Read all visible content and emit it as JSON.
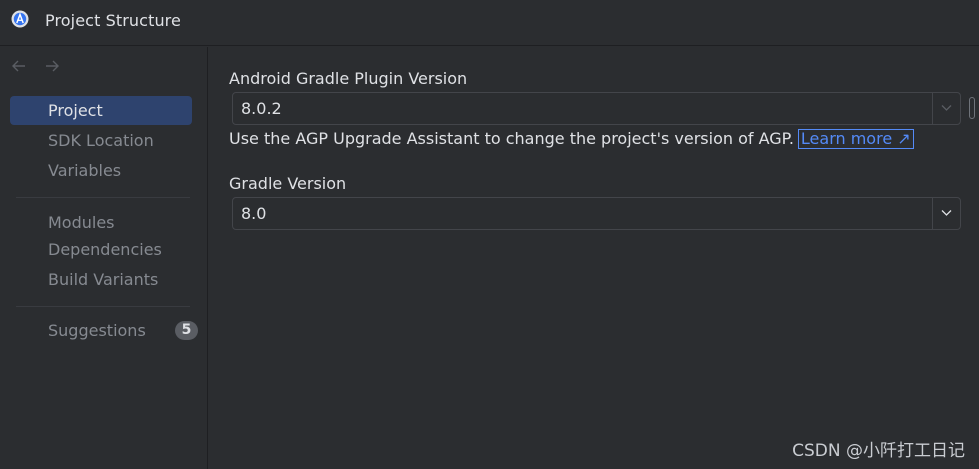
{
  "window": {
    "title": "Project Structure",
    "app_icon": "android-studio-icon"
  },
  "nav": {
    "back_icon": "arrow-left-icon",
    "forward_icon": "arrow-right-icon"
  },
  "sidebar": {
    "groups": [
      [
        {
          "label": "Project",
          "selected": true
        },
        {
          "label": "SDK Location"
        },
        {
          "label": "Variables"
        }
      ],
      [
        {
          "label": "Modules"
        },
        {
          "label": "Dependencies"
        },
        {
          "label": "Build Variants"
        }
      ],
      [
        {
          "label": "Suggestions",
          "badge": "5"
        }
      ]
    ]
  },
  "main": {
    "agp_label": "Android Gradle Plugin Version",
    "agp_value": "8.0.2",
    "hint_text": "Use the AGP Upgrade Assistant to change the project's version of AGP.",
    "learn_more": "Learn more ↗",
    "gradle_label": "Gradle Version",
    "gradle_value": "8.0"
  },
  "watermark": "CSDN @小阡打工日记",
  "colors": {
    "background": "#2b2d30",
    "selection": "#2e436e",
    "link": "#548af7",
    "text": "#dfe1e5",
    "muted_text": "#868a91"
  }
}
